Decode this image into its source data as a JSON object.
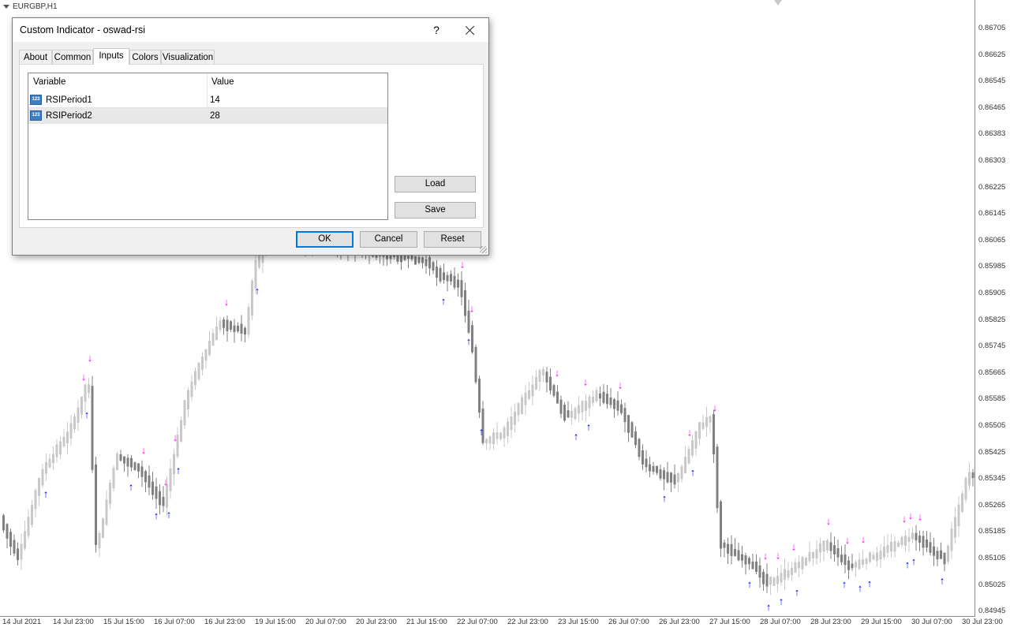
{
  "chart": {
    "symbol_label": "EURGBP,H1",
    "price_labels": [
      "0.86705",
      "0.86625",
      "0.86545",
      "0.86465",
      "0.86383",
      "0.86303",
      "0.86225",
      "0.86145",
      "0.86065",
      "0.85985",
      "0.85905",
      "0.85825",
      "0.85745",
      "0.85665",
      "0.85585",
      "0.85505",
      "0.85425",
      "0.85345",
      "0.85265",
      "0.85185",
      "0.85105",
      "0.85025",
      "0.84945"
    ],
    "time_labels": [
      "14 Jul 2021",
      "14 Jul 23:00",
      "15 Jul 15:00",
      "16 Jul 07:00",
      "16 Jul 23:00",
      "19 Jul 15:00",
      "20 Jul 07:00",
      "20 Jul 23:00",
      "21 Jul 15:00",
      "22 Jul 07:00",
      "22 Jul 23:00",
      "23 Jul 15:00",
      "26 Jul 07:00",
      "26 Jul 23:00",
      "27 Jul 15:00",
      "28 Jul 07:00",
      "28 Jul 23:00",
      "29 Jul 15:00",
      "30 Jul 07:00",
      "30 Jul 23:00"
    ],
    "colors": {
      "bull": "#c8c8c8",
      "bear": "#808080",
      "sell_arrow": "#ff00ff",
      "buy_arrow": "#0000ff"
    }
  },
  "dialog": {
    "title": "Custom Indicator - oswad-rsi",
    "help_label": "?",
    "tabs": [
      "About",
      "Common",
      "Inputs",
      "Colors",
      "Visualization"
    ],
    "active_tab": "Inputs",
    "grid": {
      "headers": [
        "Variable",
        "Value"
      ],
      "rows": [
        {
          "icon": "123",
          "name": "RSIPeriod1",
          "value": "14"
        },
        {
          "icon": "123",
          "name": "RSIPeriod2",
          "value": "28"
        }
      ]
    },
    "buttons": {
      "load": "Load",
      "save": "Save",
      "ok": "OK",
      "cancel": "Cancel",
      "reset": "Reset"
    }
  }
}
